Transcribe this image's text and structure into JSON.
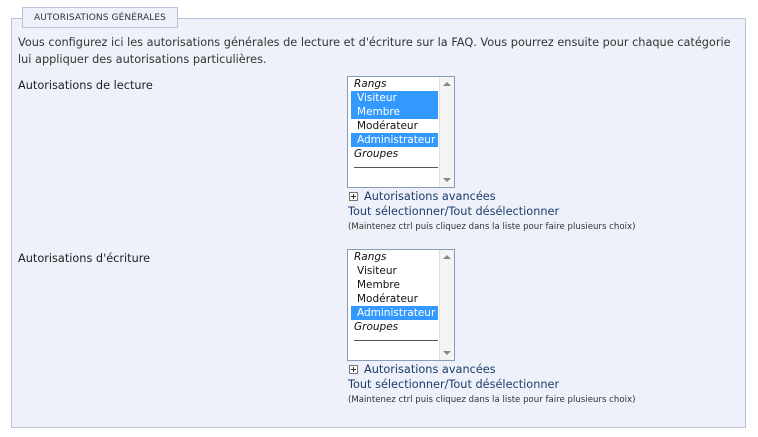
{
  "fieldset": {
    "legend": "AUTORISATIONS GÉNÉRALES",
    "intro": "Vous configurez ici les autorisations générales de lecture et d'écriture sur la FAQ. Vous pourrez ensuite pour chaque catégorie lui appliquer des autorisations particulières."
  },
  "read": {
    "label": "Autorisations de lecture",
    "options": [
      {
        "text": "Rangs",
        "group": true,
        "selected": false
      },
      {
        "text": "Visiteur",
        "group": false,
        "selected": true
      },
      {
        "text": "Membre",
        "group": false,
        "selected": true
      },
      {
        "text": "Modérateur",
        "group": false,
        "selected": false
      },
      {
        "text": "Administrateur",
        "group": false,
        "selected": true
      },
      {
        "text": "Groupes",
        "group": true,
        "selected": false
      }
    ],
    "advanced_label": "Autorisations avancées",
    "select_all_label": "Tout sélectionner/Tout désélectionner",
    "hint": "(Maintenez ctrl puis cliquez dans la liste pour faire plusieurs choix)"
  },
  "write": {
    "label": "Autorisations d'écriture",
    "options": [
      {
        "text": "Rangs",
        "group": true,
        "selected": false
      },
      {
        "text": "Visiteur",
        "group": false,
        "selected": false
      },
      {
        "text": "Membre",
        "group": false,
        "selected": false
      },
      {
        "text": "Modérateur",
        "group": false,
        "selected": false
      },
      {
        "text": "Administrateur",
        "group": false,
        "selected": true
      },
      {
        "text": "Groupes",
        "group": true,
        "selected": false
      }
    ],
    "advanced_label": "Autorisations avancées",
    "select_all_label": "Tout sélectionner/Tout désélectionner",
    "hint": "(Maintenez ctrl puis cliquez dans la liste pour faire plusieurs choix)"
  },
  "colors": {
    "panel_bg": "#eef1f9",
    "border": "#b9c4db",
    "selection": "#3399ff",
    "link": "#1a3d6e"
  }
}
